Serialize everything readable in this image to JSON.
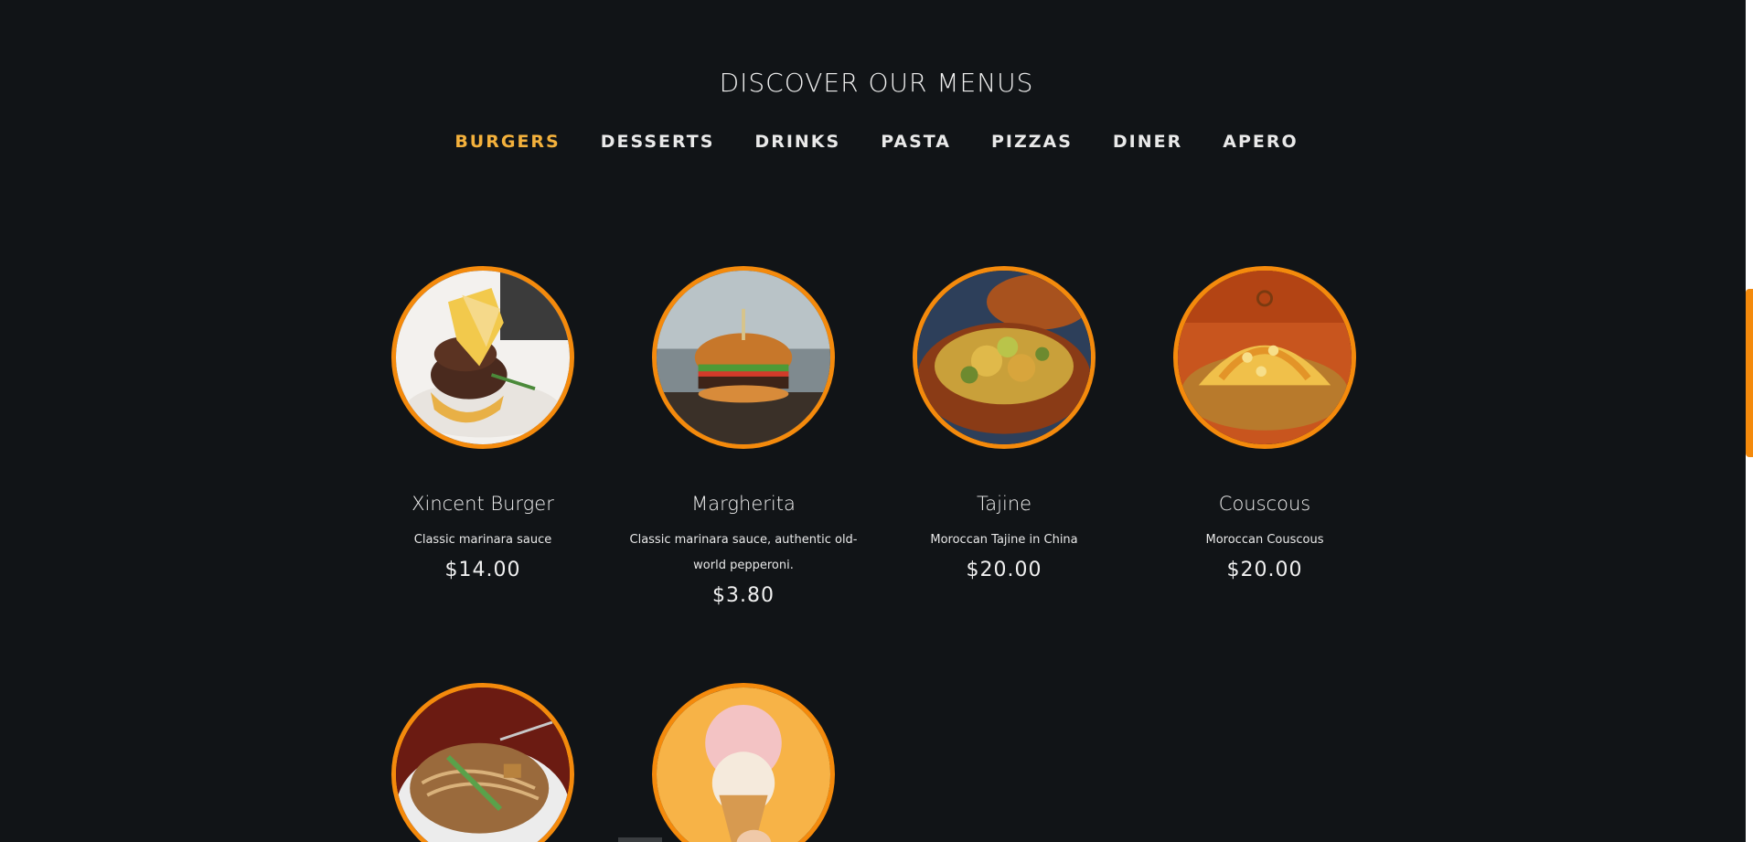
{
  "section": {
    "title": "DISCOVER OUR MENUS"
  },
  "tabs": [
    {
      "label": "BURGERS",
      "active": true
    },
    {
      "label": "DESSERTS",
      "active": false
    },
    {
      "label": "DRINKS",
      "active": false
    },
    {
      "label": "PASTA",
      "active": false
    },
    {
      "label": "PIZZAS",
      "active": false
    },
    {
      "label": "DINER",
      "active": false
    },
    {
      "label": "APERO",
      "active": false
    }
  ],
  "menu": {
    "items": [
      {
        "name": "Xincent Burger",
        "description": "Classic marinara sauce",
        "price": "$14.00",
        "image": "stacked-burger-plate"
      },
      {
        "name": "Margherita",
        "description": "Classic marinara sauce, authentic old-world pepperoni.",
        "price": "$3.80",
        "image": "burger-on-board"
      },
      {
        "name": "Tajine",
        "description": "Moroccan Tajine in China",
        "price": "$20.00",
        "image": "tajine-pot"
      },
      {
        "name": "Couscous",
        "description": "Moroccan Couscous",
        "price": "$20.00",
        "image": "couscous-platter"
      },
      {
        "image": "noodle-plate"
      },
      {
        "image": "ice-cream-cone"
      }
    ]
  },
  "colors": {
    "background": "#111417",
    "accent": "#f48a0c",
    "active_tab": "#f4b13c",
    "text": "#f0f0f0"
  }
}
